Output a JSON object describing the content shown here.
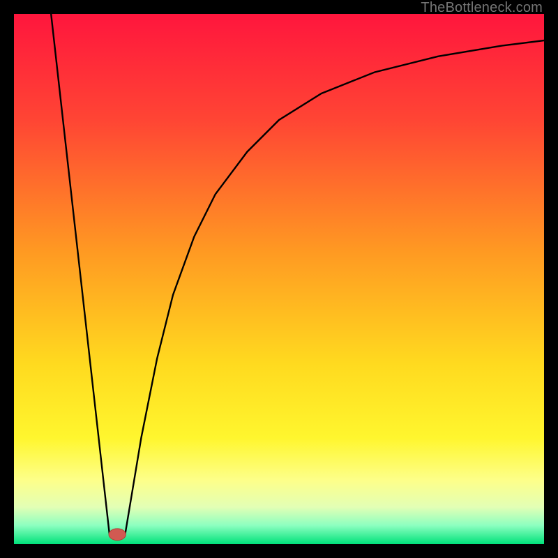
{
  "watermark": "TheBottleneck.com",
  "colors": {
    "frame": "#000000",
    "gradient_stops": [
      {
        "offset": 0.0,
        "color": "#ff163d"
      },
      {
        "offset": 0.2,
        "color": "#ff4534"
      },
      {
        "offset": 0.45,
        "color": "#ff9a22"
      },
      {
        "offset": 0.66,
        "color": "#ffda1f"
      },
      {
        "offset": 0.8,
        "color": "#fff62e"
      },
      {
        "offset": 0.88,
        "color": "#fdff8a"
      },
      {
        "offset": 0.93,
        "color": "#e3ffb5"
      },
      {
        "offset": 0.965,
        "color": "#8cffc0"
      },
      {
        "offset": 1.0,
        "color": "#00e27a"
      }
    ],
    "curve": "#000000",
    "marker_fill": "#d15a52",
    "marker_stroke": "#b24038"
  },
  "chart_data": {
    "type": "line",
    "title": "",
    "xlabel": "",
    "ylabel": "",
    "xlim": [
      0,
      100
    ],
    "ylim": [
      0,
      100
    ],
    "legend": null,
    "series": [
      {
        "name": "left-branch",
        "x": [
          7,
          18
        ],
        "y": [
          100,
          2
        ]
      },
      {
        "name": "valley-floor",
        "x": [
          18,
          21
        ],
        "y": [
          2,
          2
        ]
      },
      {
        "name": "right-branch",
        "x": [
          21,
          24,
          27,
          30,
          34,
          38,
          44,
          50,
          58,
          68,
          80,
          92,
          100
        ],
        "y": [
          2,
          20,
          35,
          47,
          58,
          66,
          74,
          80,
          85,
          89,
          92,
          94,
          95
        ]
      }
    ],
    "marker": {
      "x": 19.5,
      "y": 1.8,
      "rx": 1.6,
      "ry": 1.1
    }
  }
}
